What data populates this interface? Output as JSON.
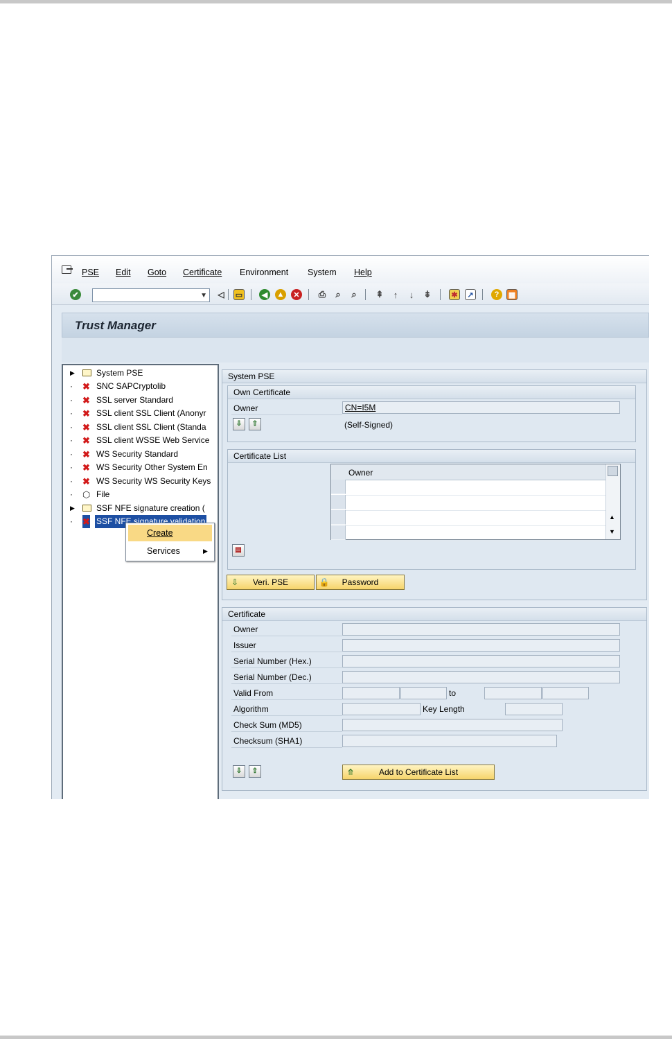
{
  "menu": {
    "items": [
      "PSE",
      "Edit",
      "Goto",
      "Certificate",
      "Environment",
      "System",
      "Help"
    ]
  },
  "toolbar": {
    "command_value": ""
  },
  "title": "Trust Manager",
  "tree": {
    "nodes": [
      {
        "label": "System PSE",
        "kind": "folder",
        "expander": "arrow"
      },
      {
        "label": "SNC SAPCryptolib",
        "kind": "error",
        "expander": "dot"
      },
      {
        "label": "SSL server Standard",
        "kind": "error",
        "expander": "dot"
      },
      {
        "label": "SSL client SSL Client (Anonyr",
        "kind": "error",
        "expander": "dot"
      },
      {
        "label": "SSL client SSL Client (Standa",
        "kind": "error",
        "expander": "dot"
      },
      {
        "label": "SSL client WSSE Web Service",
        "kind": "error",
        "expander": "dot"
      },
      {
        "label": "WS Security Standard",
        "kind": "error",
        "expander": "dot"
      },
      {
        "label": "WS Security Other System En",
        "kind": "error",
        "expander": "dot"
      },
      {
        "label": "WS Security WS Security Keys",
        "kind": "error",
        "expander": "dot"
      },
      {
        "label": "File",
        "kind": "file",
        "expander": "dot"
      },
      {
        "label": "SSF NFE signature creation (",
        "kind": "folder",
        "expander": "arrow"
      },
      {
        "label": "SSF NFE signature validation",
        "kind": "error",
        "expander": "dot",
        "selected": true
      }
    ]
  },
  "context_menu": {
    "create": "Create",
    "services": "Services"
  },
  "system_pse": {
    "title": "System PSE",
    "own_cert": {
      "title": "Own Certificate",
      "owner_label": "Owner",
      "owner_value": "CN=I5M",
      "self_signed": "(Self-Signed)"
    },
    "cert_list": {
      "title": "Certificate List",
      "col_owner": "Owner"
    },
    "veri_pse": "Veri. PSE",
    "password": "Password"
  },
  "certificate": {
    "title": "Certificate",
    "owner": "Owner",
    "issuer": "Issuer",
    "serial_hex": "Serial Number (Hex.)",
    "serial_dec": "Serial Number (Dec.)",
    "valid_from": "Valid From",
    "to": "to",
    "algorithm": "Algorithm",
    "key_length": "Key Length",
    "checksum_md5": "Check Sum (MD5)",
    "checksum_sha1": "Checksum (SHA1)",
    "add_button": "Add to Certificate List"
  }
}
